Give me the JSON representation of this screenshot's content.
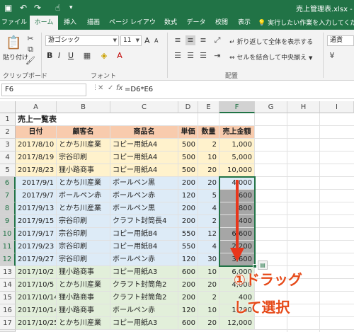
{
  "window": {
    "title": "売上管理表.xlsx - Ex"
  },
  "ribbon_tabs": [
    "ファイル",
    "ホーム",
    "挿入",
    "描画",
    "ページ レイアウト",
    "数式",
    "データ",
    "校閲",
    "表示"
  ],
  "tell_me": "実行したい作業を入力してくださ",
  "ribbon": {
    "paste": "貼り付け",
    "clipboard_group": "クリップボード",
    "font_name": "游ゴシック",
    "font_size": "11",
    "font_group": "フォント",
    "bold": "B",
    "italic": "I",
    "underline": "U",
    "grow_font": "A",
    "shrink_font": "A",
    "wrap_text": "折り返して全体を表示する",
    "merge_center": "セルを結合して中央揃え",
    "alignment_group": "配置",
    "number_format": "通貨"
  },
  "formula_bar": {
    "cell_ref": "F6",
    "formula": "=D6*E6",
    "cancel": "✕",
    "enter": "✓",
    "fx": "fx"
  },
  "columns": [
    "A",
    "B",
    "C",
    "D",
    "E",
    "F",
    "G",
    "H",
    "I"
  ],
  "selected_column": "F",
  "rows": [
    "1",
    "2",
    "3",
    "4",
    "5",
    "6",
    "7",
    "8",
    "9",
    "10",
    "11",
    "12",
    "13",
    "14",
    "15",
    "16",
    "17",
    "18"
  ],
  "sheet": {
    "title": "売上一覧表",
    "headers": [
      "日付",
      "顧客名",
      "商品名",
      "単価",
      "数量",
      "売上金額"
    ],
    "data": [
      [
        "2017/8/10",
        "とかち川産業",
        "コピー用紙A4",
        "500",
        "2",
        "1,000"
      ],
      [
        "2017/8/19",
        "宗谷印刷",
        "コピー用紙A4",
        "500",
        "10",
        "5,000"
      ],
      [
        "2017/8/23",
        "狸小路商事",
        "コピー用紙A4",
        "500",
        "20",
        "10,000"
      ],
      [
        "2017/9/1",
        "とかち川産業",
        "ボールペン黒",
        "200",
        "20",
        "4,000"
      ],
      [
        "2017/9/7",
        "ボールペン赤",
        "ボールペン赤",
        "120",
        "5",
        "600"
      ],
      [
        "2017/9/13",
        "とかち川産業",
        "ボールペン黒",
        "200",
        "4",
        "800"
      ],
      [
        "2017/9/15",
        "宗谷印刷",
        "クラフト封筒長4",
        "200",
        "2",
        "400"
      ],
      [
        "2017/9/17",
        "宗谷印刷",
        "コピー用紙B4",
        "550",
        "12",
        "6,600"
      ],
      [
        "2017/9/23",
        "宗谷印刷",
        "コピー用紙B4",
        "550",
        "4",
        "2,200"
      ],
      [
        "2017/9/27",
        "宗谷印刷",
        "ボールペン赤",
        "120",
        "30",
        "3,600"
      ],
      [
        "2017/10/2",
        "狸小路商事",
        "コピー用紙A3",
        "600",
        "10",
        "6,000"
      ],
      [
        "2017/10/5",
        "とかち川産業",
        "クラフト封筒角2",
        "200",
        "20",
        "4,000"
      ],
      [
        "2017/10/14",
        "狸小路商事",
        "クラフト封筒角2",
        "200",
        "2",
        "400"
      ],
      [
        "2017/10/14",
        "狸小路商事",
        "ボールペン赤",
        "120",
        "10",
        "1,200"
      ],
      [
        "2017/10/25",
        "とかち川産業",
        "コピー用紙A3",
        "600",
        "20",
        "12,000"
      ]
    ]
  },
  "annotation": {
    "line1": "①ドラッグ",
    "line2": "して選択"
  },
  "colors": {
    "excel_green": "#217346",
    "header_fill": "#f8cbad",
    "annotation": "#e64a19"
  }
}
